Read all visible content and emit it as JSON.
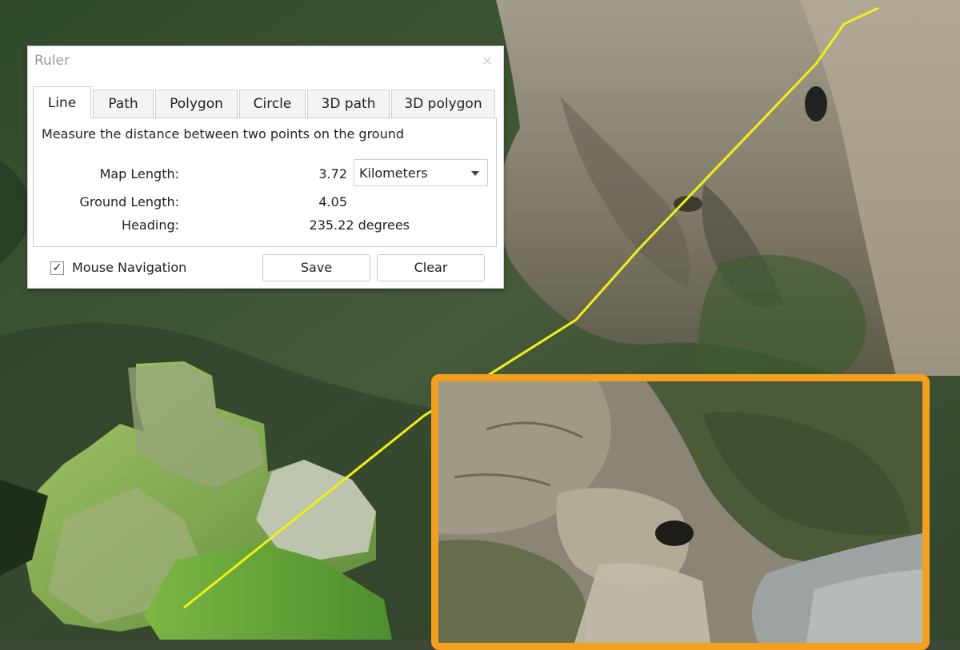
{
  "ruler": {
    "title": "Ruler",
    "close_symbol": "×",
    "tabs": [
      {
        "label": "Line",
        "active": true
      },
      {
        "label": "Path"
      },
      {
        "label": "Polygon"
      },
      {
        "label": "Circle"
      },
      {
        "label": "3D path"
      },
      {
        "label": "3D polygon"
      }
    ],
    "description": "Measure the distance between two points on the ground",
    "map_length_label": "Map Length:",
    "map_length_value": "3.72",
    "unit_selected": "Kilometers",
    "ground_length_label": "Ground Length:",
    "ground_length_value": "4.05",
    "heading_label": "Heading:",
    "heading_value": "235.22 degrees",
    "mouse_navigation_label": "Mouse Navigation",
    "mouse_navigation_checked": true,
    "checkmark": "✓",
    "save_label": "Save",
    "clear_label": "Clear"
  },
  "map": {
    "measure_line_color": "#f2ee1a",
    "inset_border_color": "#f3a020"
  }
}
